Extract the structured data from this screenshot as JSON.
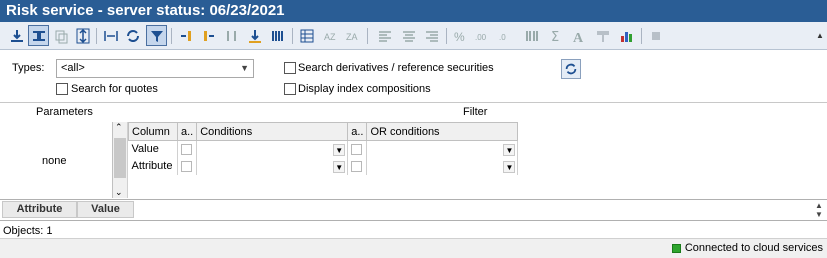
{
  "window": {
    "title": "Risk service - server status: 06/23/2021"
  },
  "options": {
    "types_label": "Types:",
    "types_value": "<all>",
    "search_quotes_label": "Search for quotes",
    "search_derivatives_label": "Search derivatives / reference securities",
    "display_index_label": "Display index compositions"
  },
  "filter": {
    "parameters_header": "Parameters",
    "filter_header": "Filter",
    "parameters_value": "none",
    "columns": [
      "Column",
      "a..",
      "Conditions",
      "a..",
      "OR conditions"
    ],
    "rows": [
      {
        "column": "Value"
      },
      {
        "column": "Attribute"
      }
    ]
  },
  "results": {
    "columns": [
      "Attribute",
      "Value"
    ]
  },
  "objects_count": "Objects: 1",
  "status": {
    "text": "Connected to cloud services",
    "color": "#2ea52e"
  }
}
